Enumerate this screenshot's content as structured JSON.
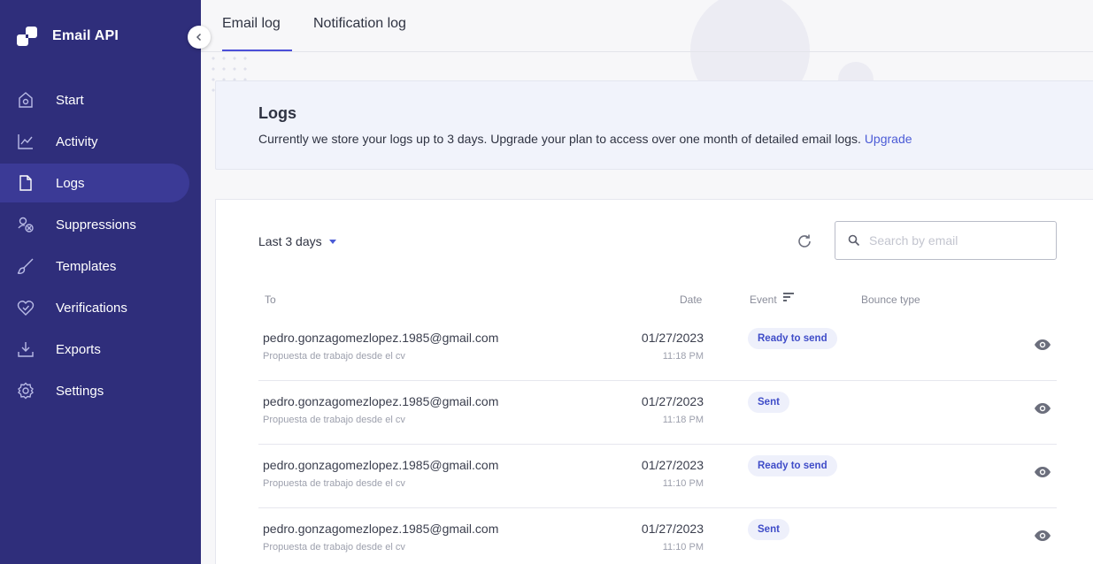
{
  "app": {
    "title": "Email API"
  },
  "sidebar": {
    "items": [
      {
        "label": "Start",
        "icon": "home-icon"
      },
      {
        "label": "Activity",
        "icon": "chart-icon"
      },
      {
        "label": "Logs",
        "icon": "document-icon",
        "active": true
      },
      {
        "label": "Suppressions",
        "icon": "suppression-icon"
      },
      {
        "label": "Templates",
        "icon": "brush-icon"
      },
      {
        "label": "Verifications",
        "icon": "heart-check-icon"
      },
      {
        "label": "Exports",
        "icon": "download-icon"
      },
      {
        "label": "Settings",
        "icon": "gear-icon"
      }
    ]
  },
  "tabs": [
    {
      "label": "Email log",
      "active": true
    },
    {
      "label": "Notification log",
      "active": false
    }
  ],
  "banner": {
    "title": "Logs",
    "text": "Currently we store your logs up to 3 days. Upgrade your plan to access over one month of detailed email logs.",
    "link": "Upgrade"
  },
  "filters": {
    "range": "Last 3 days",
    "search_placeholder": "Search by email"
  },
  "table": {
    "headers": {
      "to": "To",
      "date": "Date",
      "event": "Event",
      "bounce": "Bounce type"
    },
    "rows": [
      {
        "email": "pedro.gonzagomezlopez.1985@gmail.com",
        "subject": "Propuesta de trabajo desde el cv",
        "date": "01/27/2023",
        "time": "11:18 PM",
        "event": "Ready to send"
      },
      {
        "email": "pedro.gonzagomezlopez.1985@gmail.com",
        "subject": "Propuesta de trabajo desde el cv",
        "date": "01/27/2023",
        "time": "11:18 PM",
        "event": "Sent"
      },
      {
        "email": "pedro.gonzagomezlopez.1985@gmail.com",
        "subject": "Propuesta de trabajo desde el cv",
        "date": "01/27/2023",
        "time": "11:10 PM",
        "event": "Ready to send"
      },
      {
        "email": "pedro.gonzagomezlopez.1985@gmail.com",
        "subject": "Propuesta de trabajo desde el cv",
        "date": "01/27/2023",
        "time": "11:10 PM",
        "event": "Sent"
      }
    ]
  },
  "colors": {
    "sidebar": "#2f2e7b",
    "accent": "#4b4fd8",
    "badge_bg": "#eef0fb",
    "badge_text": "#3f4cc8"
  }
}
